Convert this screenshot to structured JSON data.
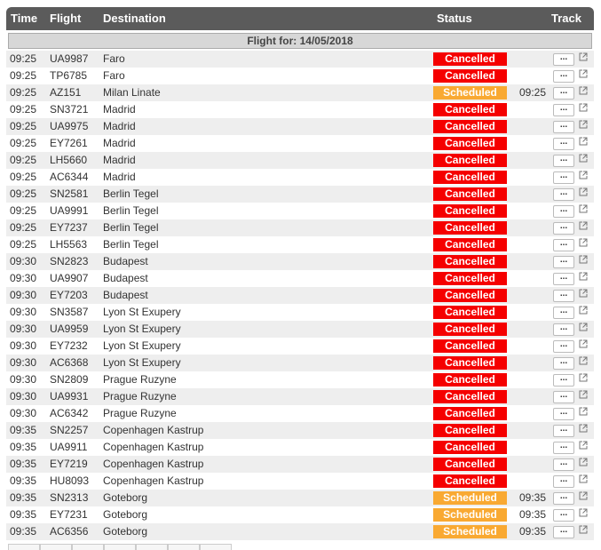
{
  "header": {
    "time": "Time",
    "flight": "Flight",
    "destination": "Destination",
    "status": "Status",
    "track": "Track"
  },
  "date_label": "Flight for: 14/05/2018",
  "colors": {
    "cancelled": "#f50000",
    "scheduled": "#f9a932",
    "header_bg": "#5b5b5b"
  },
  "more_label": "...",
  "flights": [
    {
      "time": "09:25",
      "flight": "UA9987",
      "destination": "Faro",
      "status": "Cancelled",
      "est": ""
    },
    {
      "time": "09:25",
      "flight": "TP6785",
      "destination": "Faro",
      "status": "Cancelled",
      "est": ""
    },
    {
      "time": "09:25",
      "flight": "AZ151",
      "destination": "Milan Linate",
      "status": "Scheduled",
      "est": "09:25"
    },
    {
      "time": "09:25",
      "flight": "SN3721",
      "destination": "Madrid",
      "status": "Cancelled",
      "est": ""
    },
    {
      "time": "09:25",
      "flight": "UA9975",
      "destination": "Madrid",
      "status": "Cancelled",
      "est": ""
    },
    {
      "time": "09:25",
      "flight": "EY7261",
      "destination": "Madrid",
      "status": "Cancelled",
      "est": ""
    },
    {
      "time": "09:25",
      "flight": "LH5660",
      "destination": "Madrid",
      "status": "Cancelled",
      "est": ""
    },
    {
      "time": "09:25",
      "flight": "AC6344",
      "destination": "Madrid",
      "status": "Cancelled",
      "est": ""
    },
    {
      "time": "09:25",
      "flight": "SN2581",
      "destination": "Berlin Tegel",
      "status": "Cancelled",
      "est": ""
    },
    {
      "time": "09:25",
      "flight": "UA9991",
      "destination": "Berlin Tegel",
      "status": "Cancelled",
      "est": ""
    },
    {
      "time": "09:25",
      "flight": "EY7237",
      "destination": "Berlin Tegel",
      "status": "Cancelled",
      "est": ""
    },
    {
      "time": "09:25",
      "flight": "LH5563",
      "destination": "Berlin Tegel",
      "status": "Cancelled",
      "est": ""
    },
    {
      "time": "09:30",
      "flight": "SN2823",
      "destination": "Budapest",
      "status": "Cancelled",
      "est": ""
    },
    {
      "time": "09:30",
      "flight": "UA9907",
      "destination": "Budapest",
      "status": "Cancelled",
      "est": ""
    },
    {
      "time": "09:30",
      "flight": "EY7203",
      "destination": "Budapest",
      "status": "Cancelled",
      "est": ""
    },
    {
      "time": "09:30",
      "flight": "SN3587",
      "destination": "Lyon St Exupery",
      "status": "Cancelled",
      "est": ""
    },
    {
      "time": "09:30",
      "flight": "UA9959",
      "destination": "Lyon St Exupery",
      "status": "Cancelled",
      "est": ""
    },
    {
      "time": "09:30",
      "flight": "EY7232",
      "destination": "Lyon St Exupery",
      "status": "Cancelled",
      "est": ""
    },
    {
      "time": "09:30",
      "flight": "AC6368",
      "destination": "Lyon St Exupery",
      "status": "Cancelled",
      "est": ""
    },
    {
      "time": "09:30",
      "flight": "SN2809",
      "destination": "Prague Ruzyne",
      "status": "Cancelled",
      "est": ""
    },
    {
      "time": "09:30",
      "flight": "UA9931",
      "destination": "Prague Ruzyne",
      "status": "Cancelled",
      "est": ""
    },
    {
      "time": "09:30",
      "flight": "AC6342",
      "destination": "Prague Ruzyne",
      "status": "Cancelled",
      "est": ""
    },
    {
      "time": "09:35",
      "flight": "SN2257",
      "destination": "Copenhagen Kastrup",
      "status": "Cancelled",
      "est": ""
    },
    {
      "time": "09:35",
      "flight": "UA9911",
      "destination": "Copenhagen Kastrup",
      "status": "Cancelled",
      "est": ""
    },
    {
      "time": "09:35",
      "flight": "EY7219",
      "destination": "Copenhagen Kastrup",
      "status": "Cancelled",
      "est": ""
    },
    {
      "time": "09:35",
      "flight": "HU8093",
      "destination": "Copenhagen Kastrup",
      "status": "Cancelled",
      "est": ""
    },
    {
      "time": "09:35",
      "flight": "SN2313",
      "destination": "Goteborg",
      "status": "Scheduled",
      "est": "09:35"
    },
    {
      "time": "09:35",
      "flight": "EY7231",
      "destination": "Goteborg",
      "status": "Scheduled",
      "est": "09:35"
    },
    {
      "time": "09:35",
      "flight": "AC6356",
      "destination": "Goteborg",
      "status": "Scheduled",
      "est": "09:35"
    }
  ]
}
